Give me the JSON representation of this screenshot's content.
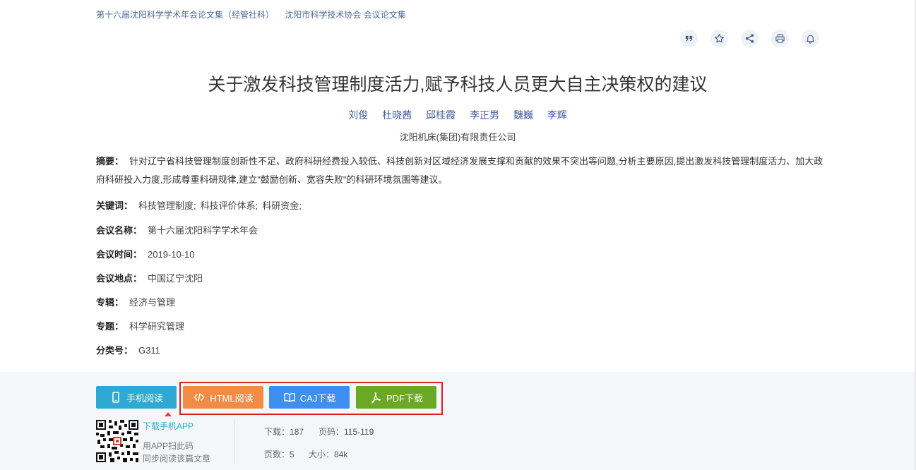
{
  "breadcrumb": {
    "items": [
      "第十六届沈阳科学学术年会论文集（经管社科）",
      "沈阳市科学技术协会 会议论文集"
    ]
  },
  "toolbar": {
    "icons": [
      "quote-icon",
      "star-icon",
      "share-icon",
      "print-icon",
      "bell-icon"
    ]
  },
  "article": {
    "title": "关于激发科技管理制度活力,赋予科技人员更大自主决策权的建议",
    "authors": [
      "刘俊",
      "杜晓茜",
      "邱桂霞",
      "李正男",
      "魏巍",
      "李辉"
    ],
    "organization": "沈阳机床(集团)有限责任公司",
    "abstract_label": "摘要：",
    "abstract_text": "针对辽宁省科技管理制度创新性不足、政府科研经费投入较低、科技创新对区域经济发展支撑和贡献的效果不突出等问题,分析主要原因,提出激发科技管理制度活力、加大政府科研投入力度,形成尊重科研规律,建立\"鼓励创新、宽容失败\"的科研环境氛围等建议。",
    "keywords_label": "关键词：",
    "keywords": [
      "科技管理制度;",
      "科技评价体系;",
      "科研资金;"
    ],
    "meeting_name_label": "会议名称：",
    "meeting_name": "第十六届沈阳科学学术年会",
    "meeting_time_label": "会议时间：",
    "meeting_time": "2019-10-10",
    "meeting_place_label": "会议地点：",
    "meeting_place": "中国辽宁沈阳",
    "series_label": "专辑：",
    "series": "经济与管理",
    "topic_label": "专题：",
    "topic": "科学研究管理",
    "classification_label": "分类号：",
    "classification": "G311"
  },
  "actions": {
    "mobile_read": "手机阅读",
    "html_read": "HTML阅读",
    "caj_download": "CAJ下载",
    "pdf_download": "PDF下载"
  },
  "app": {
    "download_link": "下载手机APP",
    "tip_line1": "用APP扫此码",
    "tip_line2": "同步阅读该篇文章"
  },
  "stats": {
    "downloads_label": "下载：",
    "downloads": "187",
    "pages_range_label": "页码：",
    "pages_range": "115-119",
    "page_count_label": "页数：",
    "page_count": "5",
    "size_label": "大小：",
    "size": "84k"
  },
  "colors": {
    "mobile": "#2fa9d4",
    "html": "#f18c46",
    "caj": "#3e8ff0",
    "pdf": "#6aa825",
    "highlight": "#e02020"
  }
}
